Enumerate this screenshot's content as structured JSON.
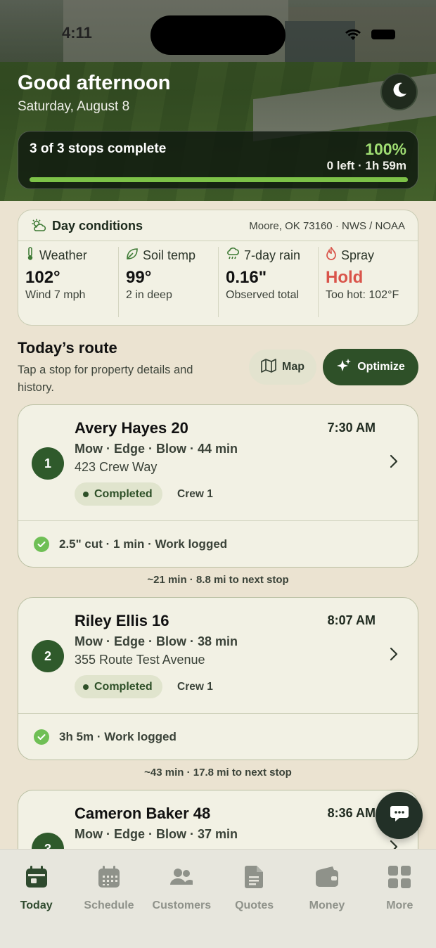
{
  "status_bar": {
    "time": "4:11"
  },
  "header": {
    "greeting": "Good afternoon",
    "date": "Saturday, August 8"
  },
  "progress": {
    "title": "3 of 3 stops complete",
    "percent_label": "100%",
    "detail": "0 left · 1h 59m",
    "fraction": 1.0,
    "color": "#7dc248"
  },
  "conditions": {
    "title": "Day conditions",
    "location": "Moore, OK 73160 · NWS / NOAA",
    "columns": [
      {
        "label": "Weather",
        "value": "102°",
        "sub": "Wind 7 mph",
        "icon": "thermometer-icon"
      },
      {
        "label": "Soil temp",
        "value": "99°",
        "sub": "2 in deep",
        "icon": "leaf-icon"
      },
      {
        "label": "7-day rain",
        "value": "0.16\"",
        "sub": "Observed total",
        "icon": "rain-cloud-icon"
      },
      {
        "label": "Spray",
        "value": "Hold",
        "sub": "Too hot: 102°F",
        "icon": "flame-icon"
      }
    ]
  },
  "route": {
    "title": "Today’s route",
    "subtitle": "Tap a stop for property details and history.",
    "map_label": "Map",
    "optimize_label": "Optimize"
  },
  "stops": [
    {
      "number": "1",
      "name": "Avery Hayes 20",
      "time": "7:30 AM",
      "services": "Mow · Edge · Blow · 44 min",
      "address": "423 Crew Way",
      "status": "Completed",
      "crew": "Crew 1",
      "log": "2.5\" cut · 1 min · Work logged"
    },
    {
      "number": "2",
      "name": "Riley Ellis 16",
      "time": "8:07 AM",
      "services": "Mow · Edge · Blow · 38 min",
      "address": "355 Route Test Avenue",
      "status": "Completed",
      "crew": "Crew 1",
      "log": "3h 5m · Work logged"
    },
    {
      "number": "3",
      "name": "Cameron Baker 48",
      "time": "8:36 AM",
      "services": "Mow · Edge · Blow · 37 min"
    }
  ],
  "legs": [
    "~21 min · 8.8 mi to next stop",
    "~43 min · 17.8 mi to next stop"
  ],
  "tabs": [
    {
      "label": "Today",
      "icon": "calendar-today-icon",
      "active": true
    },
    {
      "label": "Schedule",
      "icon": "calendar-grid-icon"
    },
    {
      "label": "Customers",
      "icon": "people-icon"
    },
    {
      "label": "Quotes",
      "icon": "document-icon"
    },
    {
      "label": "Money",
      "icon": "wallet-icon"
    },
    {
      "label": "More",
      "icon": "grid-icon"
    }
  ],
  "colors": {
    "brand_green": "#2e5028",
    "accent_green": "#7dc248",
    "hold_red": "#d9544a",
    "background": "#ebe3d1"
  }
}
